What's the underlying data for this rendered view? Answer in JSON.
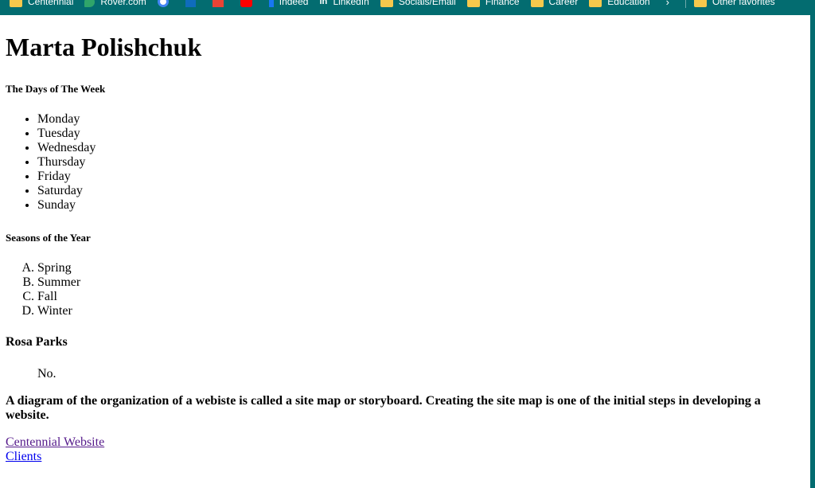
{
  "favorites_bar": {
    "items": [
      {
        "label": "Centennial",
        "icon": "folder-icon"
      },
      {
        "label": "Rover.com",
        "icon": "rover-icon"
      },
      {
        "label": "",
        "icon": "google-icon"
      },
      {
        "label": "",
        "icon": "outlook-icon"
      },
      {
        "label": "",
        "icon": "gmail-icon"
      },
      {
        "label": "",
        "icon": "youtube-icon"
      },
      {
        "label": "Indeed",
        "icon": "facebook-icon"
      },
      {
        "label": "LinkedIn",
        "icon": "linkedin-icon"
      },
      {
        "label": "Socials/Email",
        "icon": "folder-icon"
      },
      {
        "label": "Finance",
        "icon": "folder-icon"
      },
      {
        "label": "Career",
        "icon": "folder-icon"
      },
      {
        "label": "Education",
        "icon": "folder-icon"
      }
    ],
    "overflow_icon": "chevron-right-icon",
    "other_favorites": "Other favorites",
    "bar_color": "#036c70"
  },
  "page": {
    "title": "Marta Polishchuk",
    "days_heading": "The Days of The Week",
    "days": [
      "Monday",
      "Tuesday",
      "Wednesday",
      "Thursday",
      "Friday",
      "Saturday",
      "Sunday"
    ],
    "seasons_heading": "Seasons of the Year",
    "seasons": [
      "Spring",
      "Summer",
      "Fall",
      "Winter"
    ],
    "person_heading": "Rosa Parks",
    "person_quote": "No.",
    "paragraph": "A diagram of the organization of a webiste is called a site map or storyboard. Creating the site map is one of the initial steps in developing a website.",
    "links": [
      {
        "label": "Centennial Website",
        "visited": true
      },
      {
        "label": "Clients",
        "visited": false
      }
    ]
  }
}
